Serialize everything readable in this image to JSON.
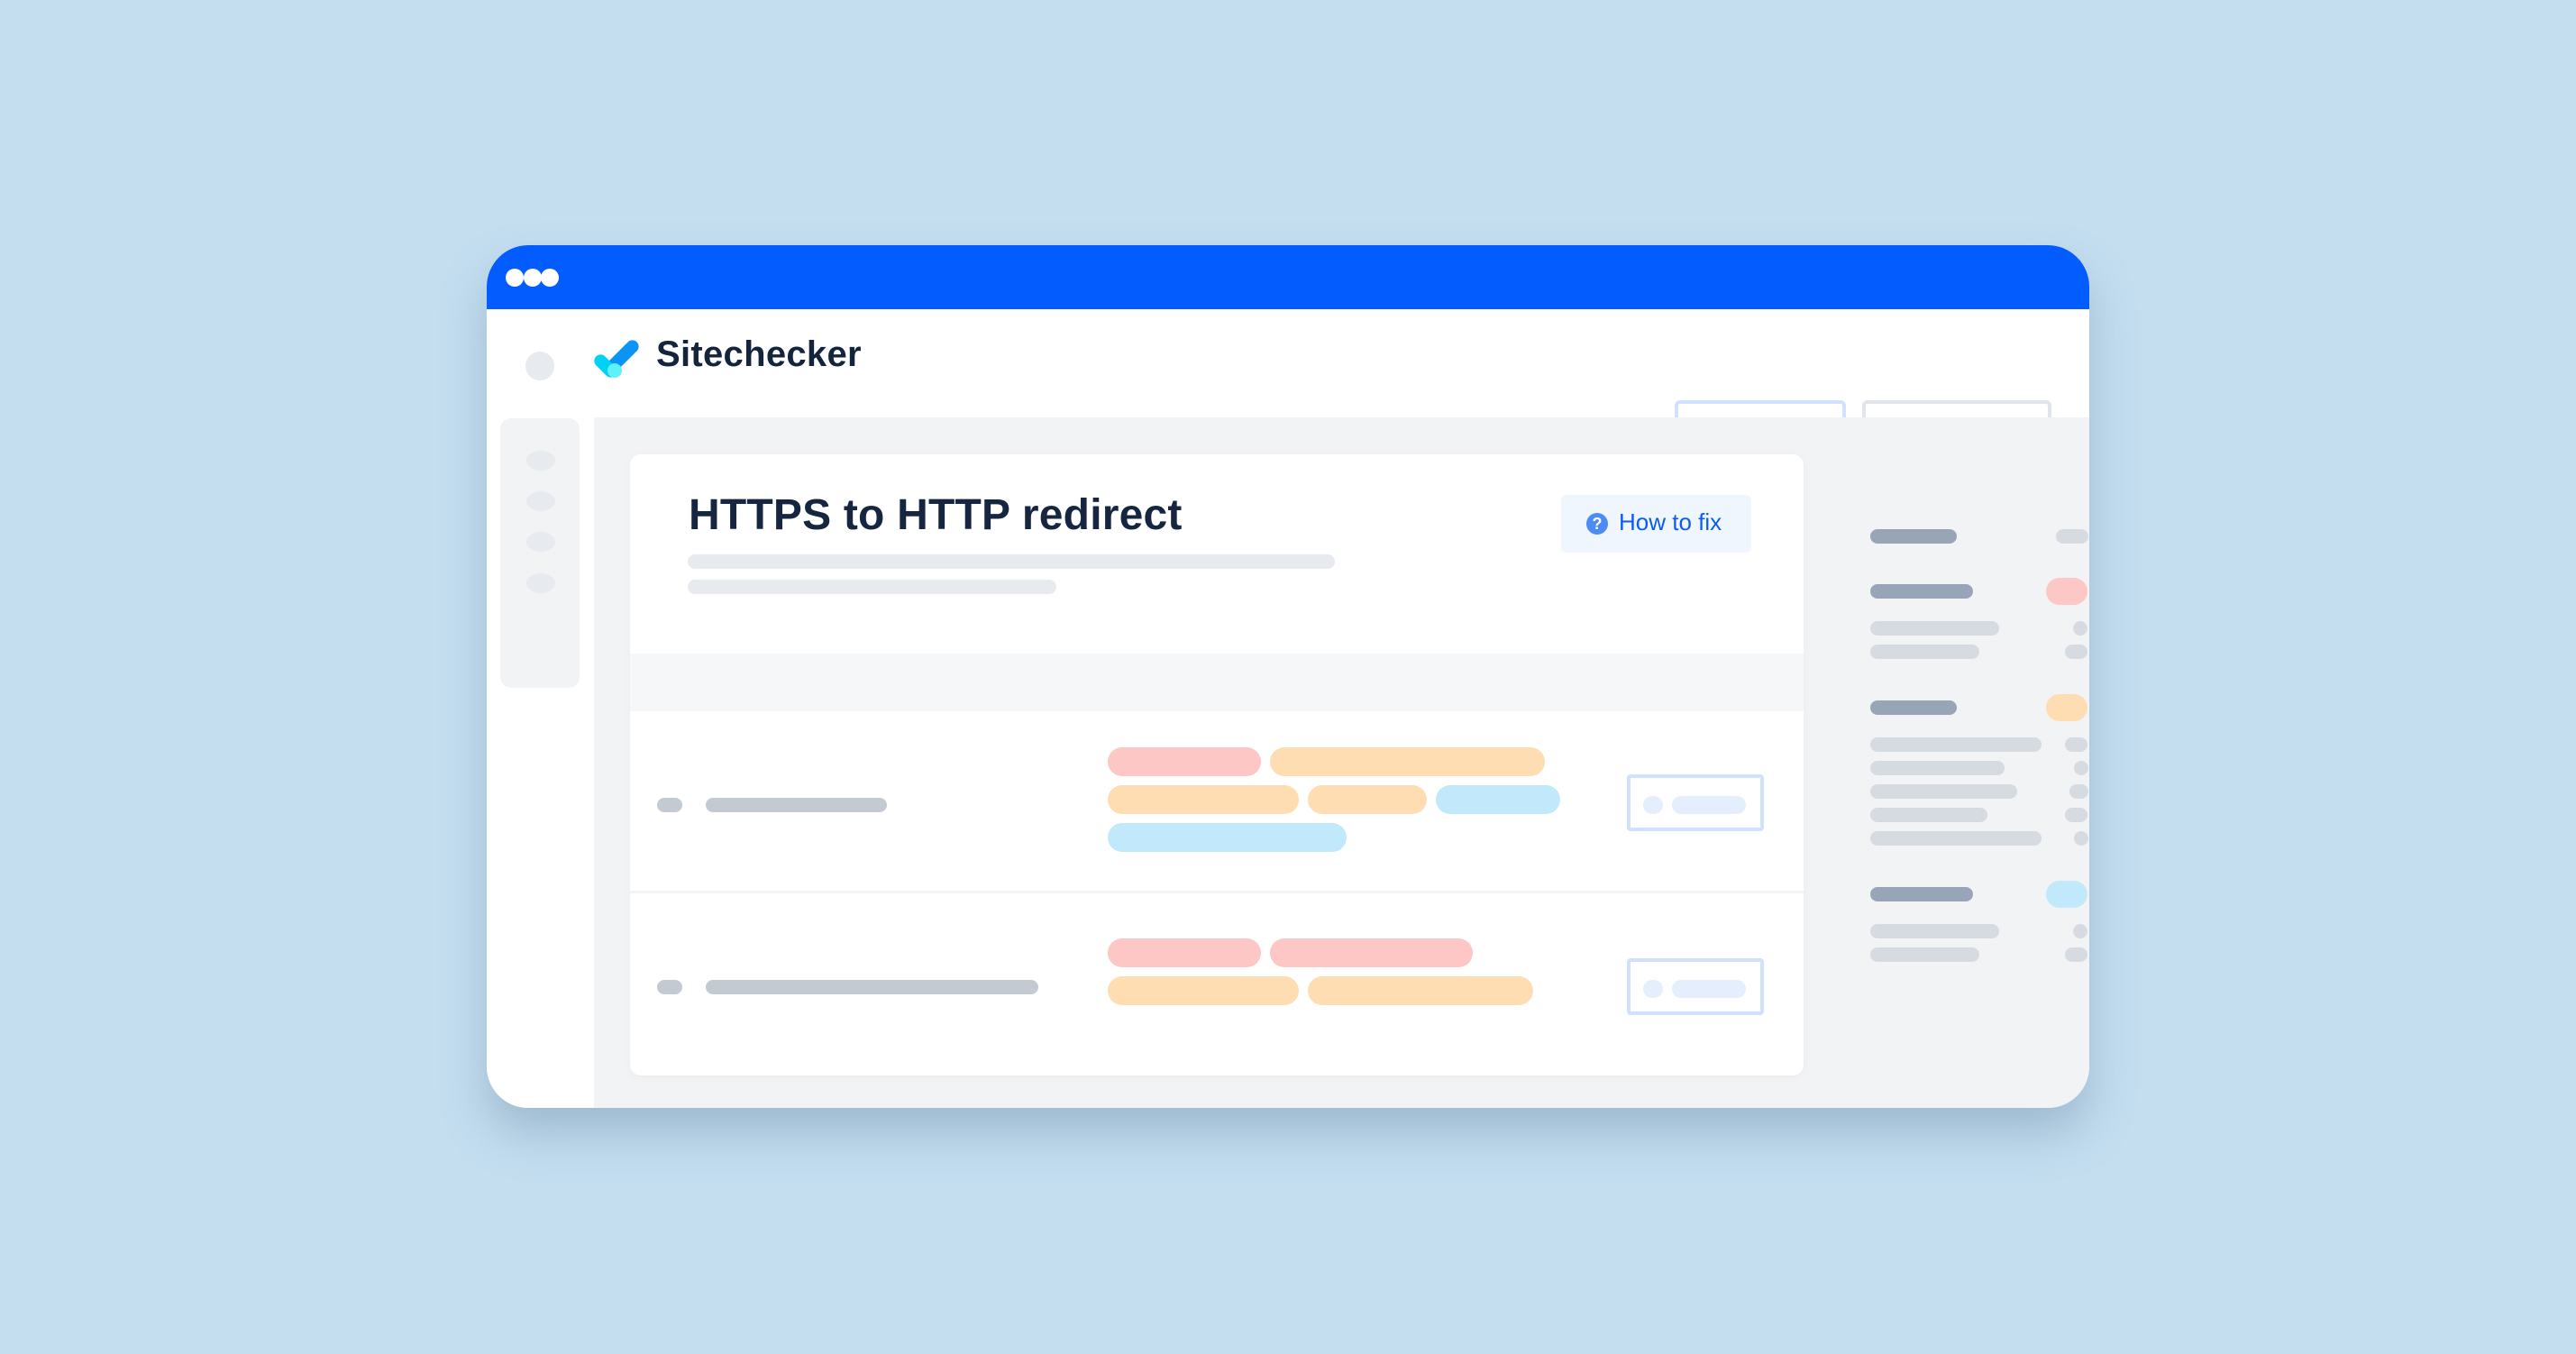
{
  "window": {
    "titlebar_color": "#025cfe",
    "titlebar_dots": 3
  },
  "header": {
    "brand_name": "Sitechecker",
    "logo_icon": "checkmark-logo-icon",
    "buttons": [
      {
        "name": "primary-placeholder-button",
        "style": "blue-outline"
      },
      {
        "name": "secondary-placeholder-button",
        "style": "gray-outline"
      }
    ]
  },
  "sidebar": {
    "item_count": 4,
    "icon": "placeholder-dot-icon"
  },
  "card": {
    "title": "HTTPS to HTTP redirect",
    "how_to_fix_label": "How to fix",
    "how_to_fix_icon": "question-circle-icon",
    "how_to_fix_icon_glyph": "?",
    "rows": [
      {
        "tags": [
          {
            "color": "red",
            "row": 0
          },
          {
            "color": "orange",
            "row": 0
          },
          {
            "color": "orange",
            "row": 1
          },
          {
            "color": "orange",
            "row": 1
          },
          {
            "color": "blue",
            "row": 1
          },
          {
            "color": "blue",
            "row": 2
          }
        ]
      },
      {
        "tags": [
          {
            "color": "red",
            "row": 0
          },
          {
            "color": "red",
            "row": 0
          },
          {
            "color": "orange",
            "row": 1
          },
          {
            "color": "orange",
            "row": 1
          }
        ]
      }
    ]
  },
  "right_panel": {
    "groups": [
      {
        "badge_color": "gray",
        "subitems": 0
      },
      {
        "badge_color": "red",
        "subitems": 2
      },
      {
        "badge_color": "orange",
        "subitems": 5
      },
      {
        "badge_color": "blue",
        "subitems": 2
      }
    ]
  },
  "colors": {
    "background": "#c4def0",
    "brand_blue": "#025cfe",
    "title_text": "#172640",
    "link_blue": "#0c5cf2",
    "tag_red": "#fcc7c4",
    "tag_orange": "#feddb3",
    "tag_blue": "#c1e8fb",
    "skeleton_dark": "#98a5b6",
    "skeleton_light": "#d6dbe2"
  }
}
